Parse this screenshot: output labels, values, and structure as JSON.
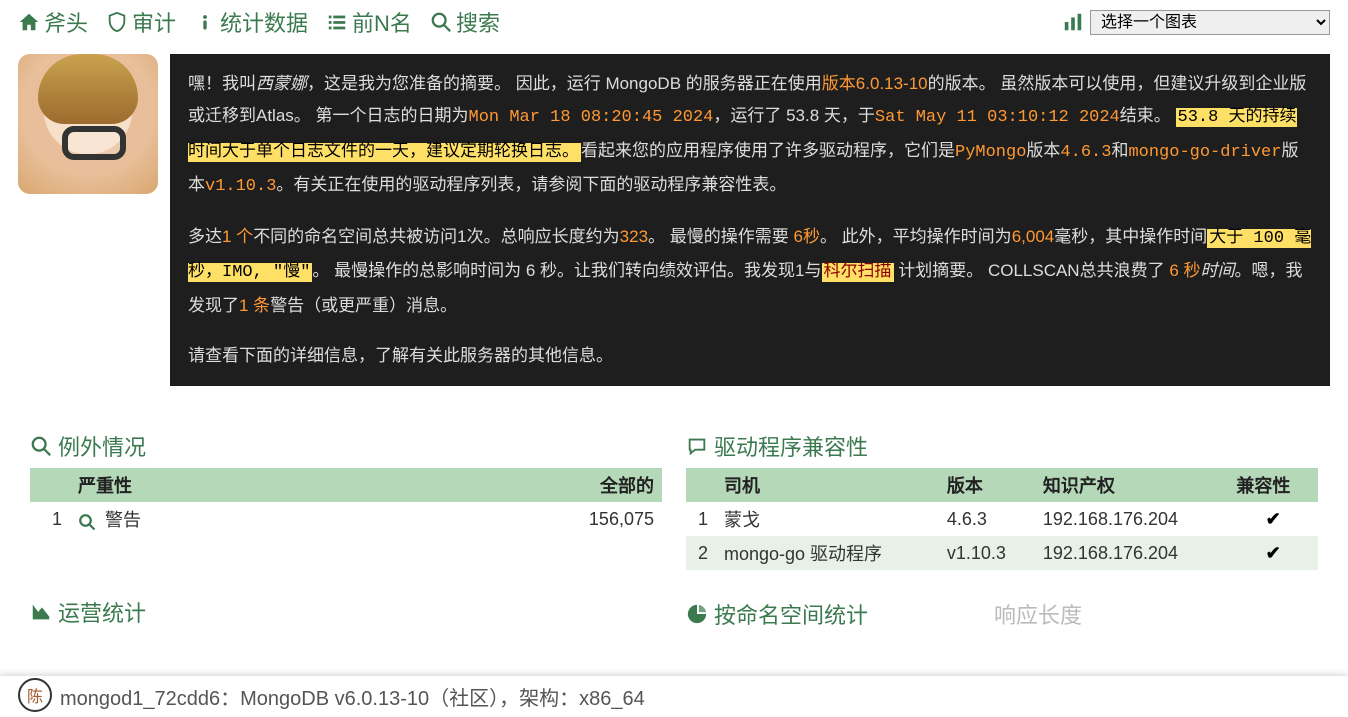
{
  "nav": {
    "home": "斧头",
    "audit": "审计",
    "stats": "统计数据",
    "topn": "前N名",
    "search": "搜索",
    "chart_select_placeholder": "选择一个图表"
  },
  "summary": {
    "intro_a": "嘿！我叫",
    "name": "西蒙娜",
    "intro_b": "，这是我为您准备的摘要。 因此，运行 MongoDB 的服务器正在使用",
    "version_label": "版本6.0.13-10",
    "intro_c": "的版本。 虽然版本可以使用，但建议升级到企业版或迁移到Atlas。 第一个日志的日期为",
    "start_date": "Mon Mar 18 08:20:45 2024",
    "intro_d": "，运行了 53.8 天，于",
    "end_date": "Sat May 11 03:10:12 2024",
    "intro_e": "结束。",
    "hl_duration": "53.8 天的持续时间大于单个日志文件的一天，建议定期轮换日志。",
    "intro_f": "看起来您的应用程序使用了许多驱动程序，它们是",
    "drv1": "PyMongo",
    "drv1_v_a": "版本",
    "drv1_v": "4.6.3",
    "and": "和",
    "drv2": "mongo-go-driver",
    "drv2_v_a": "版本",
    "drv2_v": "v1.10.3",
    "intro_g": "。有关正在使用的驱动程序列表，请参阅下面的驱动程序兼容性表。",
    "p2_a": "多达",
    "p2_ns": "1 个",
    "p2_b": "不同的命名空间总共被访问1次。总响应长度约为",
    "p2_resp": "323",
    "p2_c": "。 最慢的操作需要 ",
    "p2_slow": "6秒",
    "p2_d": "。 此外，平均操作时间为",
    "p2_avg": "6,004",
    "p2_e": "毫秒，其中操作时间",
    "p2_hl_slow": "大于 100 毫秒，IMO, \"慢\"",
    "p2_f": "。 最慢操作的总影响时间为 6 秒。让我们转向绩效评估。我发现1与",
    "p2_collscan": "科尔扫描",
    "p2_g": " 计划摘要。  COLLSCAN总共浪费了 ",
    "p2_waste": "6 秒",
    "p2_h": "时间",
    "p2_i": "。嗯，我发现了",
    "p2_warn": "1 条",
    "p2_j": "警告（或更严重）消息。",
    "p3": "请查看下面的详细信息，了解有关此服务器的其他信息。"
  },
  "exceptions": {
    "title": "例外情况",
    "col_severity": "严重性",
    "col_total": "全部的",
    "rows": [
      {
        "idx": "1",
        "severity": "警告",
        "total": "156,075"
      }
    ]
  },
  "drivers": {
    "title": "驱动程序兼容性",
    "col_driver": "司机",
    "col_version": "版本",
    "col_ip": "知识产权",
    "col_compat": "兼容性",
    "rows": [
      {
        "idx": "1",
        "driver": "蒙戈",
        "version": "4.6.3",
        "ip": "192.168.176.204",
        "compat": "✔"
      },
      {
        "idx": "2",
        "driver": "mongo-go 驱动程序",
        "version": "v1.10.3",
        "ip": "192.168.176.204",
        "compat": "✔"
      }
    ]
  },
  "stats_panel": {
    "title_ops": "运营统计",
    "title_ns": "按命名空间统计",
    "dim_resp": "响应长度"
  },
  "footer": {
    "text": "mongod1_72cdd6：MongoDB v6.0.13-10（社区），架构：x86_64"
  }
}
